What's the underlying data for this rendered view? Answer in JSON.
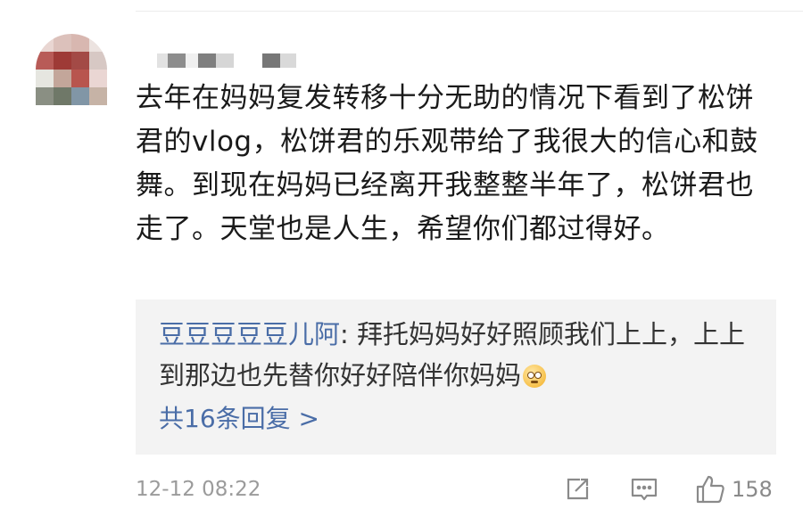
{
  "comment": {
    "text": "去年在妈妈复发转移十分无助的情况下看到了松饼君的vlog，松饼君的乐观带给了我很大的信心和鼓舞。到现在妈妈已经离开我整整半年了，松饼君也走了。天堂也是人生，希望你们都过得好。",
    "timestamp": "12-12 08:22",
    "like_count": "158"
  },
  "reply": {
    "author": "豆豆豆豆豆儿阿",
    "separator": ": ",
    "text": "拜托妈妈好好照顾我们上上，上上到那边也先替你好好陪伴你妈妈",
    "more_replies_label": "共16条回复 >"
  },
  "icons": {
    "share": "share-icon",
    "comment": "comment-icon",
    "like": "thumbs-up-icon",
    "emoji": "flushed-face-emoji"
  },
  "colors": {
    "link": "#4a6da7",
    "text": "#1a1a1a",
    "muted": "#9b9b9b",
    "reply_bg": "#f3f3f3"
  }
}
